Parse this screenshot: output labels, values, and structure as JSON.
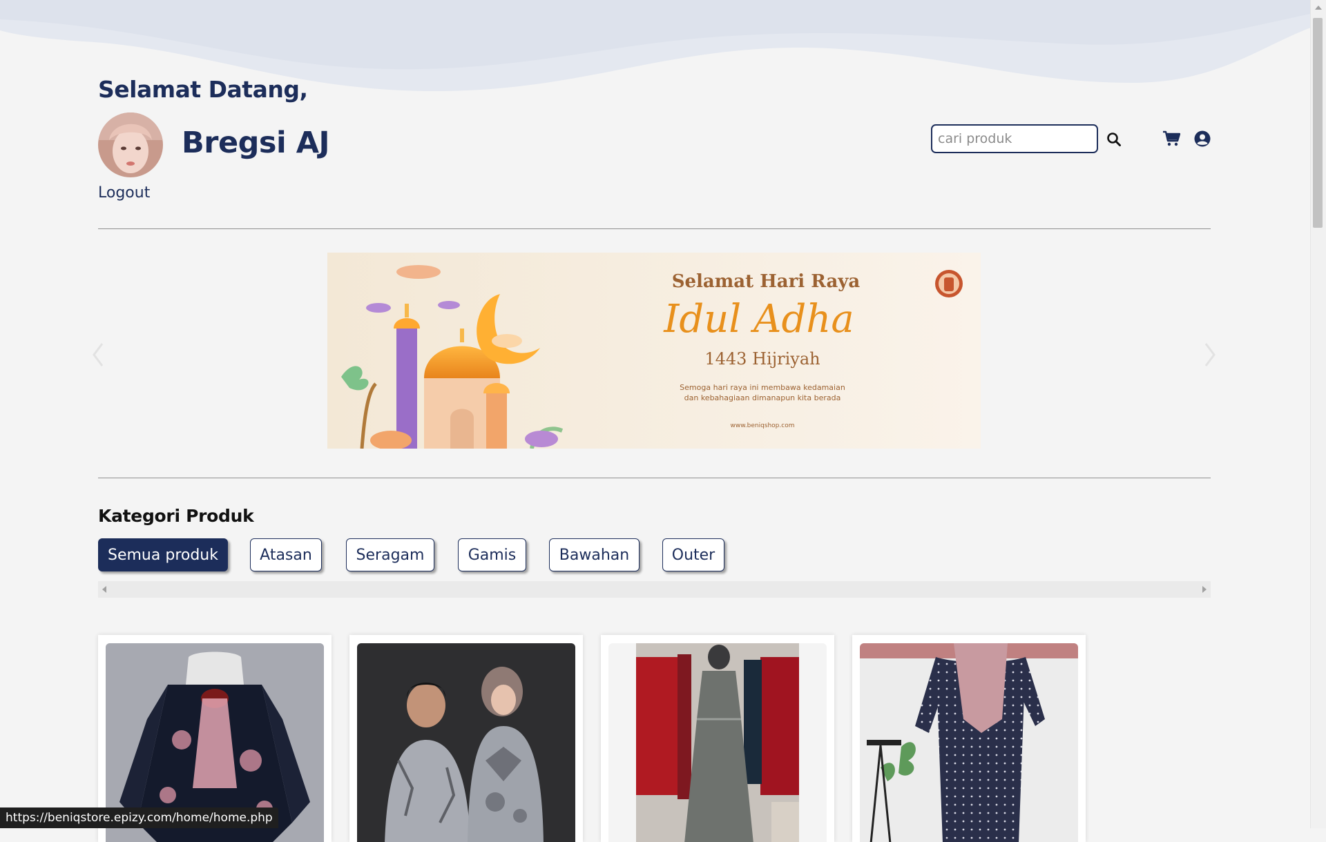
{
  "header": {
    "welcome": "Selamat Datang,",
    "username": "Bregsi AJ",
    "logout_label": "Logout",
    "search_placeholder": "cari produk"
  },
  "banner": {
    "line1": "Selamat Hari Raya",
    "line2": "Idul Adha",
    "line3": "1443 Hijriyah",
    "line4": "Semoga hari raya ini membawa kedamaian",
    "line5": "dan kebahagiaan dimanapun kita berada",
    "url": "www.beniqshop.com"
  },
  "categories": {
    "title": "Kategori Produk",
    "items": [
      "Semua produk",
      "Atasan",
      "Seragam",
      "Gamis",
      "Bawahan",
      "Outer"
    ],
    "active_index": 0
  },
  "products": {
    "icons": [
      "dress-photo",
      "couple-batik-photo",
      "gown-photo",
      "polkadot-dress-photo"
    ]
  },
  "status_bar": {
    "url": "https://beniqstore.epizy.com/home/home.php"
  },
  "colors": {
    "primary": "#1c2d5a",
    "background": "#f4f4f4",
    "wave": "#dfe3ec"
  }
}
